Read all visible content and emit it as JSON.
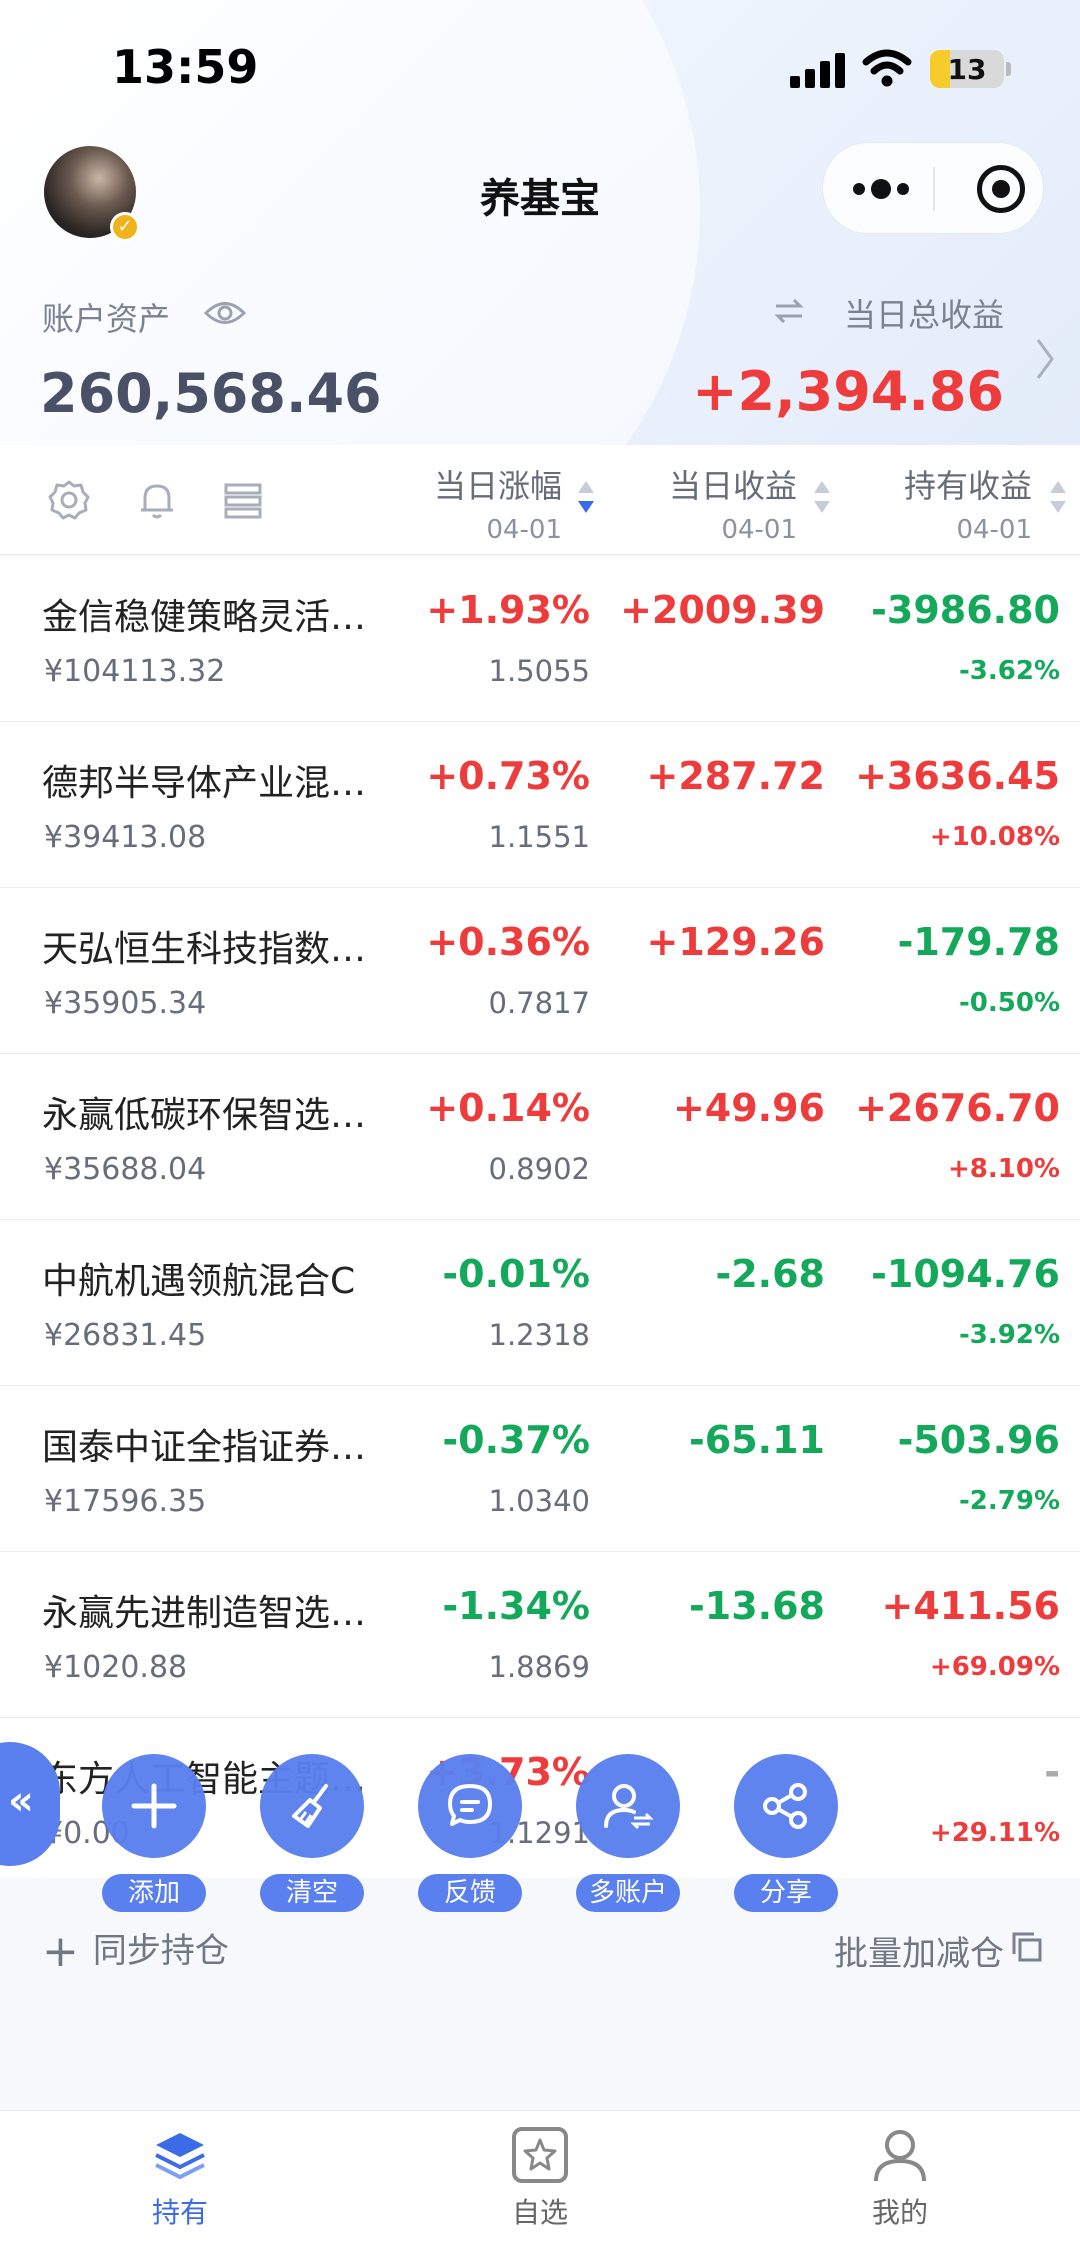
{
  "status_bar": {
    "time": "13:59",
    "battery": "13"
  },
  "header": {
    "title": "养基宝"
  },
  "summary": {
    "asset_label": "账户资产",
    "asset_value": "260,568.46",
    "profit_label": "当日总收益",
    "profit_value": "+2,394.86"
  },
  "columns": [
    {
      "title": "当日涨幅",
      "date": "04-01"
    },
    {
      "title": "当日收益",
      "date": "04-01"
    },
    {
      "title": "持有收益",
      "date": "04-01"
    }
  ],
  "funds": [
    {
      "name": "金信稳健策略灵活…",
      "amount": "¥104113.32",
      "change": "+1.93%",
      "nav": "1.5055",
      "day_profit": "+2009.39",
      "hold_profit": "-3986.80",
      "hold_pct": "-3.62%",
      "change_color": "red",
      "day_color": "red",
      "hold_color": "green"
    },
    {
      "name": "德邦半导体产业混…",
      "amount": "¥39413.08",
      "change": "+0.73%",
      "nav": "1.1551",
      "day_profit": "+287.72",
      "hold_profit": "+3636.45",
      "hold_pct": "+10.08%",
      "change_color": "red",
      "day_color": "red",
      "hold_color": "red"
    },
    {
      "name": "天弘恒生科技指数…",
      "amount": "¥35905.34",
      "change": "+0.36%",
      "nav": "0.7817",
      "day_profit": "+129.26",
      "hold_profit": "-179.78",
      "hold_pct": "-0.50%",
      "change_color": "red",
      "day_color": "red",
      "hold_color": "green"
    },
    {
      "name": "永赢低碳环保智选…",
      "amount": "¥35688.04",
      "change": "+0.14%",
      "nav": "0.8902",
      "day_profit": "+49.96",
      "hold_profit": "+2676.70",
      "hold_pct": "+8.10%",
      "change_color": "red",
      "day_color": "red",
      "hold_color": "red"
    },
    {
      "name": "中航机遇领航混合C",
      "amount": "¥26831.45",
      "change": "-0.01%",
      "nav": "1.2318",
      "day_profit": "-2.68",
      "hold_profit": "-1094.76",
      "hold_pct": "-3.92%",
      "change_color": "green",
      "day_color": "green",
      "hold_color": "green"
    },
    {
      "name": "国泰中证全指证券…",
      "amount": "¥17596.35",
      "change": "-0.37%",
      "nav": "1.0340",
      "day_profit": "-65.11",
      "hold_profit": "-503.96",
      "hold_pct": "-2.79%",
      "change_color": "green",
      "day_color": "green",
      "hold_color": "green"
    },
    {
      "name": "永赢先进制造智选…",
      "amount": "¥1020.88",
      "change": "-1.34%",
      "nav": "1.8869",
      "day_profit": "-13.68",
      "hold_profit": "+411.56",
      "hold_pct": "+69.09%",
      "change_color": "green",
      "day_color": "green",
      "hold_color": "red"
    },
    {
      "name": "东方人工智能主题…",
      "amount": "¥0.00",
      "change": "+3.73%",
      "nav": "1.1291",
      "day_profit": "",
      "hold_profit": "-",
      "hold_pct": "+29.11%",
      "change_color": "red",
      "day_color": "gray",
      "hold_color": "gray"
    }
  ],
  "actions": [
    {
      "label": "添加",
      "icon": "plus-icon"
    },
    {
      "label": "清空",
      "icon": "broom-icon"
    },
    {
      "label": "反馈",
      "icon": "chat-icon"
    },
    {
      "label": "多账户",
      "icon": "user-switch-icon"
    },
    {
      "label": "分享",
      "icon": "share-icon"
    }
  ],
  "footer_actions": {
    "sync": "同步持仓",
    "batch": "批量加减仓"
  },
  "tabs": [
    {
      "label": "持有",
      "icon": "layers-icon"
    },
    {
      "label": "自选",
      "icon": "star-icon"
    },
    {
      "label": "我的",
      "icon": "user-icon"
    }
  ],
  "colors": {
    "red": "#ee3b3b",
    "green": "#13a85a",
    "accent": "#3c6be8",
    "fab": "#5a7fee"
  }
}
